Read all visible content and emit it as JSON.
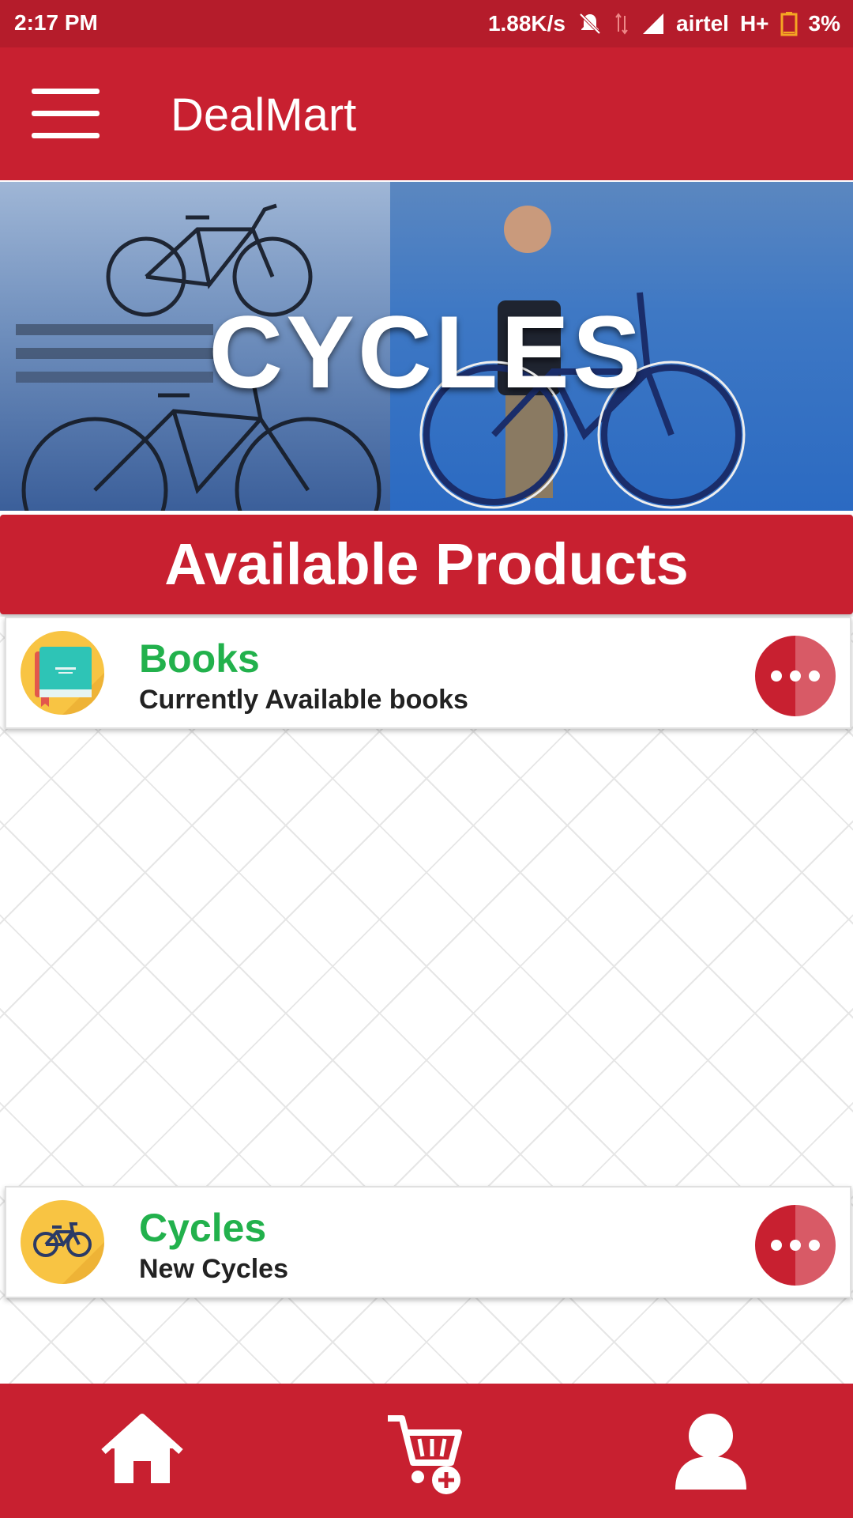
{
  "status_bar": {
    "time": "2:17 PM",
    "net_speed": "1.88K/s",
    "carrier": "airtel",
    "network_type": "H+",
    "battery": "3%"
  },
  "app_bar": {
    "title": "DealMart",
    "menu_icon": "hamburger-menu-icon"
  },
  "banner": {
    "title": "CYCLES"
  },
  "section": {
    "title": "Available Products"
  },
  "products": [
    {
      "name": "Books",
      "description": "Currently Available books",
      "icon": "book-icon"
    },
    {
      "name": "Cycles",
      "description": "New Cycles",
      "icon": "bicycle-icon"
    }
  ],
  "bottom_nav": {
    "items": [
      {
        "icon": "home-icon"
      },
      {
        "icon": "cart-add-icon"
      },
      {
        "icon": "user-icon"
      }
    ]
  },
  "colors": {
    "primary": "#c82030",
    "status_bar": "#b51c2b",
    "product_name": "#22b14c",
    "icon_bg": "#f8c443"
  }
}
